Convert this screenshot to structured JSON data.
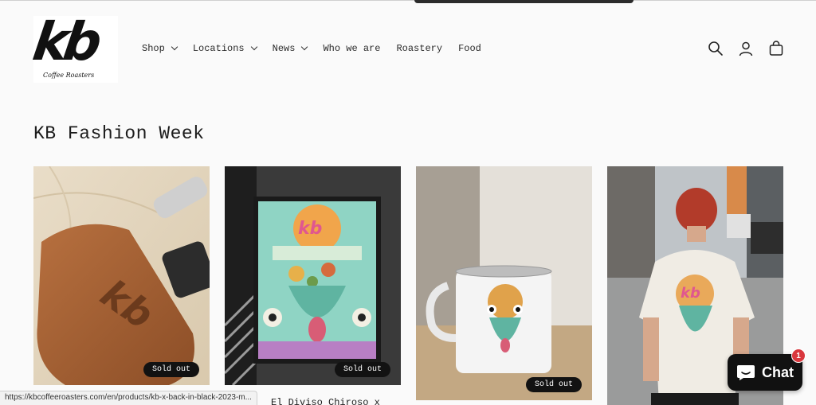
{
  "brand": {
    "logo_text": "kb",
    "logo_subtext": "Coffee Roasters"
  },
  "nav": {
    "items": [
      {
        "label": "Shop",
        "has_dropdown": true
      },
      {
        "label": "Locations",
        "has_dropdown": true
      },
      {
        "label": "News",
        "has_dropdown": true
      },
      {
        "label": "Who we are",
        "has_dropdown": false
      },
      {
        "label": "Roastery",
        "has_dropdown": false
      },
      {
        "label": "Food",
        "has_dropdown": false
      }
    ]
  },
  "header_icons": [
    "search-icon",
    "account-icon",
    "cart-icon"
  ],
  "page": {
    "title": "KB Fashion Week"
  },
  "products": [
    {
      "badge": "Sold out",
      "title": ""
    },
    {
      "badge": "Sold out",
      "title": "El Diviso Chiroso x"
    },
    {
      "badge": "Sold out",
      "title": ""
    },
    {
      "badge": "",
      "title": ""
    }
  ],
  "status_bar": {
    "url": "https://kbcoffeeroasters.com/en/products/kb-x-back-in-black-2023-m..."
  },
  "chat": {
    "label": "Chat",
    "unread_count": "1"
  },
  "colors": {
    "background": "#fafafa",
    "badge": "#121212",
    "chat_button": "#111111",
    "chat_badge": "#d9373d"
  }
}
